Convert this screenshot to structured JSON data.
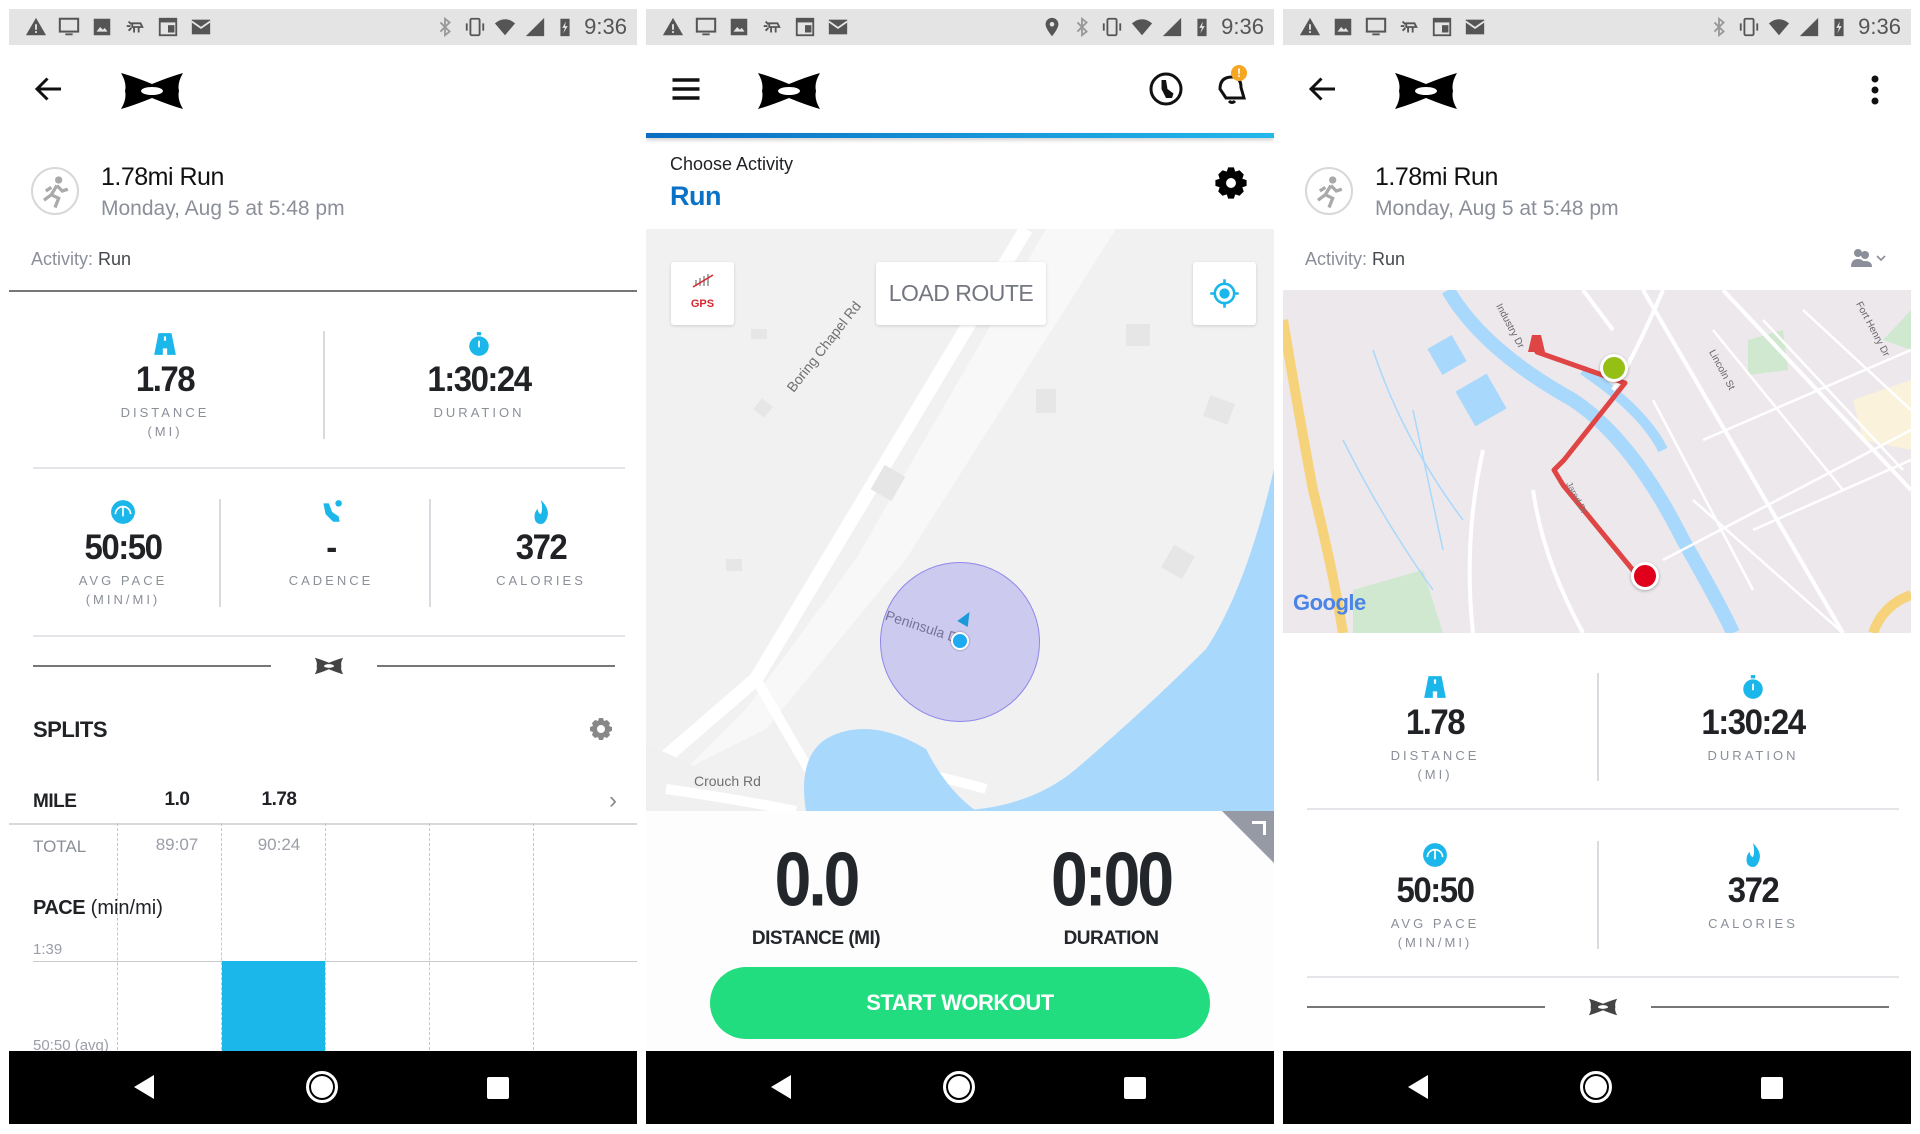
{
  "status_bar": {
    "time": "9:36",
    "left_icons": [
      "warning-icon",
      "monitor-icon",
      "image-icon",
      "drone-icon",
      "calendar-icon",
      "mail-icon"
    ],
    "right_icons": [
      "bluetooth-icon",
      "vibrate-icon",
      "wifi-icon",
      "signal-icon",
      "battery-charging-icon"
    ],
    "middle_extra_icon": "location-pin-icon"
  },
  "brand": {
    "logo": "under-armour-logo",
    "accent": "#1bb6ea",
    "run_blue": "#0a72c6",
    "start_green": "#21dd7f",
    "route_red": "#e04545"
  },
  "workout_detail": {
    "title": "1.78mi Run",
    "date": "Monday, Aug 5 at 5:48 pm",
    "activity_label": "Activity:",
    "activity_value": "Run",
    "stats": {
      "distance": {
        "value": "1.78",
        "label": "DISTANCE",
        "unit": "(MI)",
        "icon": "road-icon"
      },
      "duration": {
        "value": "1:30:24",
        "label": "DURATION",
        "icon": "stopwatch-icon"
      },
      "avg_pace": {
        "value": "50:50",
        "label": "AVG PACE",
        "unit": "(MIN/MI)",
        "icon": "speedometer-icon"
      },
      "cadence": {
        "value": "-",
        "label": "CADENCE",
        "icon": "shoe-icon"
      },
      "calories": {
        "value": "372",
        "label": "CALORIES",
        "icon": "flame-icon"
      }
    }
  },
  "splits": {
    "title": "SPLITS",
    "mile_label": "MILE",
    "total_label": "TOTAL",
    "miles": [
      "1.0",
      "1.78"
    ],
    "totals": [
      "89:07",
      "90:24"
    ],
    "pace_title_bold": "PACE",
    "pace_title_unit": "(min/mi)",
    "pace_top_tick": "1:39",
    "pace_avg_tick": "50:50 (avg)"
  },
  "chart_data": {
    "type": "bar",
    "title": "PACE (min/mi)",
    "categories": [
      "1.0",
      "1.78"
    ],
    "values_minutes": [
      null,
      99
    ],
    "ytick_labels": [
      "1:39",
      "50:50 (avg)"
    ],
    "notes": "Only the second split bar (1.78) is visible, reaching the 1:39 gridline; first split bar not visible",
    "grid": "dashed vertical column lines"
  },
  "record": {
    "choose_label": "Choose Activity",
    "activity": "Run",
    "gps_label": "GPS",
    "load_route": "LOAD ROUTE",
    "map_labels": {
      "road1": "Boring Chapel Rd",
      "road2": "Peninsula Dr",
      "road3": "Crouch Rd"
    },
    "distance_value": "0.0",
    "distance_label": "DISTANCE (MI)",
    "duration_value": "0:00",
    "duration_label": "DURATION",
    "start_button": "START WORKOUT",
    "notification_badge": "!"
  },
  "route_map": {
    "labels": {
      "industry": "Industry Dr",
      "lincoln": "Lincoln St",
      "fort_henry": "Fort Henry Dr",
      "jared": "Jared Dr"
    },
    "attribution": "Google"
  }
}
